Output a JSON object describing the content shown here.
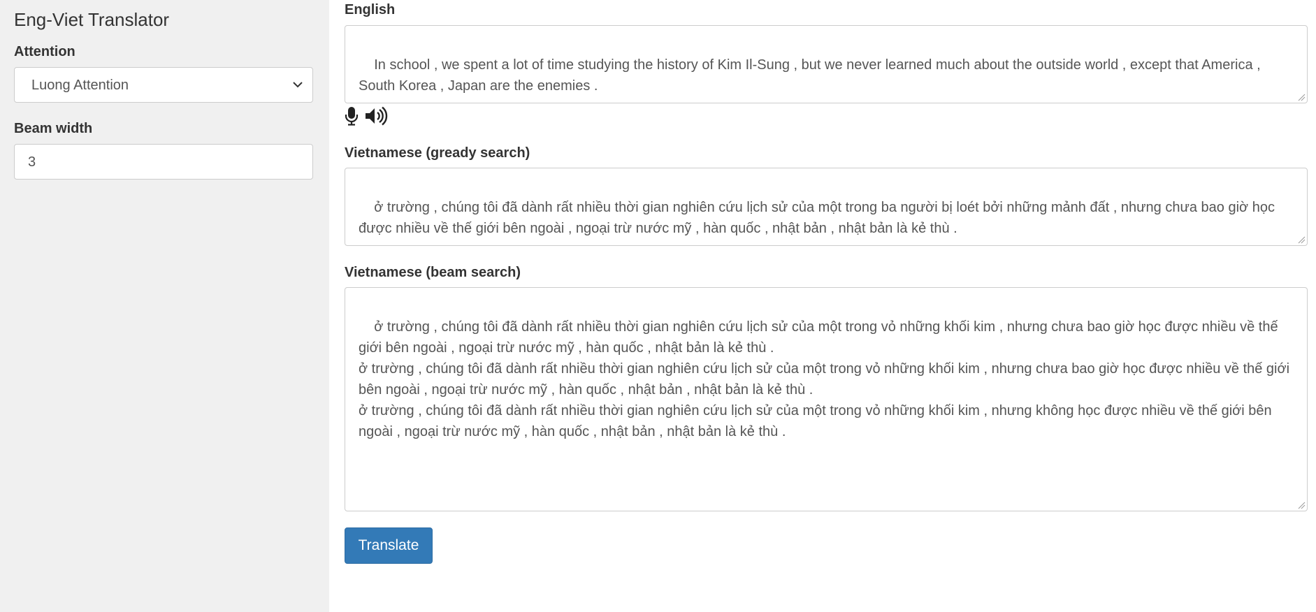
{
  "app": {
    "title": "Eng-Viet Translator"
  },
  "sidebar": {
    "attention_label": "Attention",
    "attention_value": "Luong Attention",
    "beam_label": "Beam width",
    "beam_value": "3"
  },
  "english": {
    "label": "English",
    "text": "In school , we spent a lot of time studying the history of Kim Il-Sung , but we never learned much about the outside world , except that America , South Korea , Japan are the enemies ."
  },
  "icons": {
    "mic": "microphone-icon",
    "speaker": "speaker-icon"
  },
  "greedy": {
    "label": "Vietnamese (gready search)",
    "text": "ở trường , chúng tôi đã dành rất nhiều thời gian nghiên cứu lịch sử của một trong ba người bị loét bởi những mảnh đất , nhưng chưa bao giờ học được nhiều về thế giới bên ngoài , ngoại trừ nước mỹ , hàn quốc , nhật bản , nhật bản là kẻ thù ."
  },
  "beam": {
    "label": "Vietnamese (beam search)",
    "text": "ở trường , chúng tôi đã dành rất nhiều thời gian nghiên cứu lịch sử của một trong vỏ những khối kim , nhưng chưa bao giờ học được nhiều về thế giới bên ngoài , ngoại trừ nước mỹ , hàn quốc , nhật bản là kẻ thù .\nở trường , chúng tôi đã dành rất nhiều thời gian nghiên cứu lịch sử của một trong vỏ những khối kim , nhưng chưa bao giờ học được nhiều về thế giới bên ngoài , ngoại trừ nước mỹ , hàn quốc , nhật bản , nhật bản là kẻ thù .\nở trường , chúng tôi đã dành rất nhiều thời gian nghiên cứu lịch sử của một trong vỏ những khối kim , nhưng không học được nhiều về thế giới bên ngoài , ngoại trừ nước mỹ , hàn quốc , nhật bản , nhật bản là kẻ thù ."
  },
  "actions": {
    "translate_label": "Translate"
  },
  "colors": {
    "primary": "#337ab7",
    "sidebar_bg": "#f0f0f0",
    "border": "#cccccc"
  }
}
